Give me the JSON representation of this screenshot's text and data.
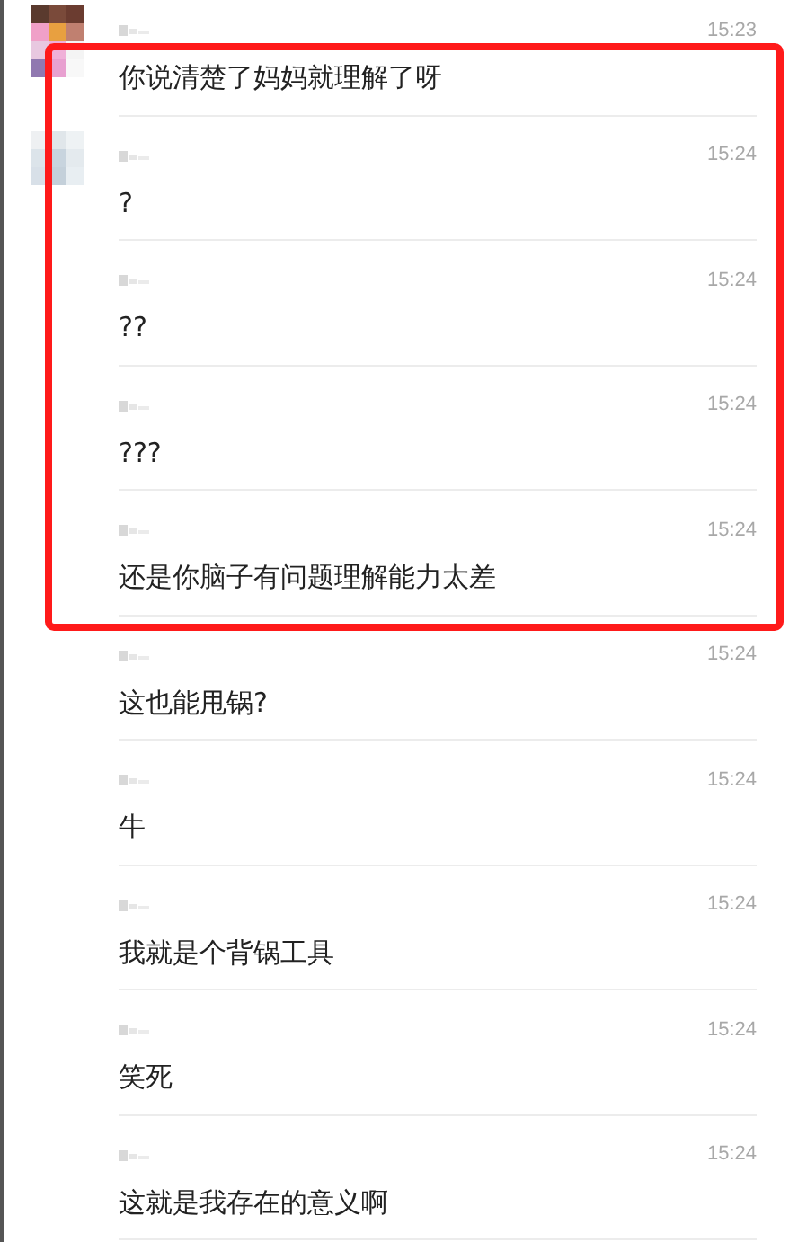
{
  "highlighted_messages": [
    {
      "avatar": true,
      "time": "15:23",
      "text": "你说清楚了妈妈就理解了呀"
    },
    {
      "avatar": true,
      "time": "15:24",
      "text": "?"
    },
    {
      "avatar": false,
      "time": "15:24",
      "text": "??"
    },
    {
      "avatar": false,
      "time": "15:24",
      "text": "???"
    },
    {
      "avatar": false,
      "time": "15:24",
      "text": "还是你脑子有问题理解能力太差"
    }
  ],
  "messages": [
    {
      "avatar": false,
      "time": "15:24",
      "text": "这也能甩锅?"
    },
    {
      "avatar": false,
      "time": "15:24",
      "text": "牛"
    },
    {
      "avatar": false,
      "time": "15:24",
      "text": "我就是个背锅工具"
    },
    {
      "avatar": false,
      "time": "15:24",
      "text": "笑死"
    },
    {
      "avatar": false,
      "time": "15:24",
      "text": "这就是我存在的意义啊"
    }
  ]
}
